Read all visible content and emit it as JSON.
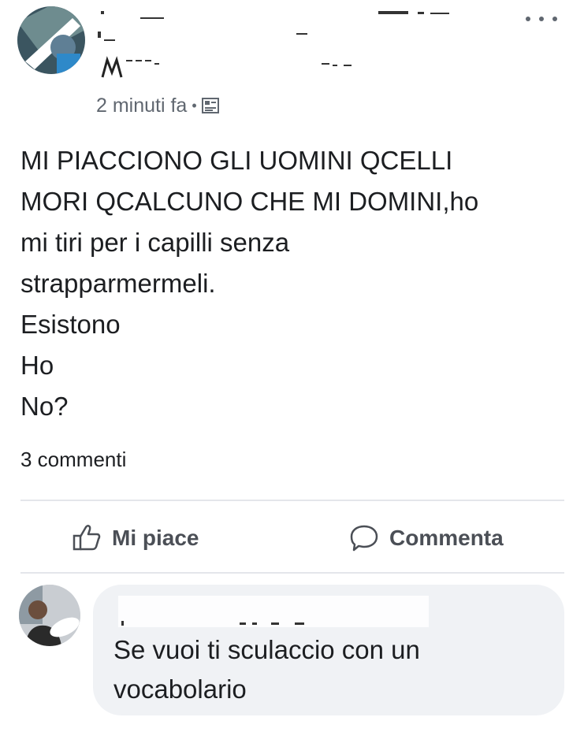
{
  "post": {
    "timestamp": "2 minuti fa",
    "separator": "•",
    "audience_icon": "photo-audience-icon",
    "lines": [
      "MI PIACCIONO GLI UOMINI QCELLI",
      "MORI QCALCUNO CHE MI DOMINI,ho",
      "mi tiri per i capilli senza",
      "strapparmermeli.",
      "Esistono",
      "Ho",
      "No?"
    ],
    "comments_count": "3 commenti"
  },
  "actions": {
    "like_label": "Mi piace",
    "comment_label": "Commenta"
  },
  "comment": {
    "lines": [
      "Se vuoi ti sculaccio con un",
      "vocabolario"
    ]
  },
  "colors": {
    "text": "#1c1e21",
    "secondary": "#606770",
    "bubble": "#f0f2f5",
    "divider": "#e4e6eb"
  }
}
